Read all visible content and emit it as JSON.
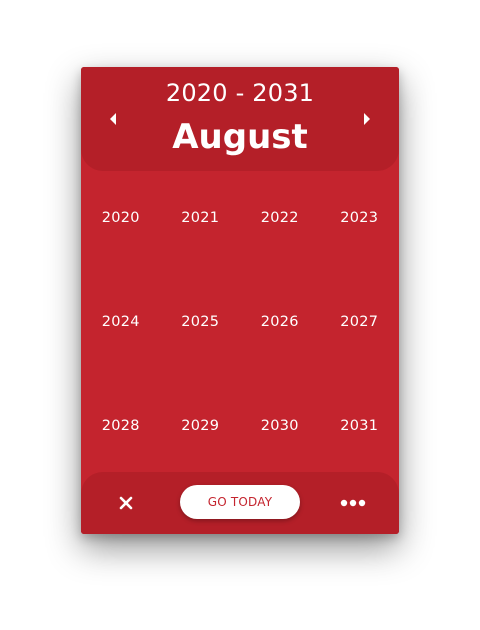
{
  "header": {
    "range": "2020 - 2031",
    "month": "August",
    "prev_icon": "triangle-left-icon",
    "next_icon": "triangle-right-icon"
  },
  "years": [
    "2020",
    "2021",
    "2022",
    "2023",
    "2024",
    "2025",
    "2026",
    "2027",
    "2028",
    "2029",
    "2030",
    "2031"
  ],
  "footer": {
    "close_icon": "close-icon",
    "today_label": "GO TODAY",
    "more_icon": "more-dots-icon"
  },
  "colors": {
    "body": "#c4242e",
    "header": "#b41f28",
    "text": "#ffffff"
  }
}
